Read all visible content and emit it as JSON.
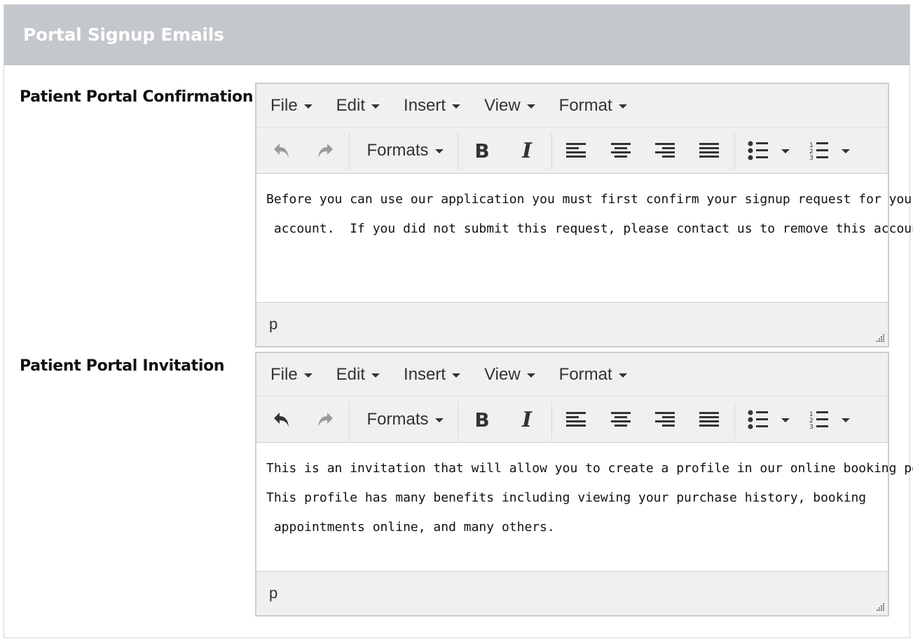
{
  "panel": {
    "title": "Portal Signup Emails"
  },
  "menus": [
    {
      "label": "File"
    },
    {
      "label": "Edit"
    },
    {
      "label": "Insert"
    },
    {
      "label": "View"
    },
    {
      "label": "Format"
    }
  ],
  "toolbar": {
    "formats_label": "Formats"
  },
  "editors": [
    {
      "label": "Patient Portal Confirmation",
      "undo_enabled": false,
      "content_lines": [
        "Before you can use our application you must first confirm your signup request for your",
        " account.  If you did not submit this request, please contact us to remove this account."
      ],
      "path": "p"
    },
    {
      "label": "Patient Portal Invitation",
      "undo_enabled": true,
      "content_lines": [
        "This is an invitation that will allow you to create a profile in our online booking portal.",
        "This profile has many benefits including viewing your purchase history, booking",
        " appointments online, and many others."
      ],
      "path": "p"
    }
  ],
  "icons": [
    "undo-icon",
    "redo-icon",
    "bold-icon",
    "italic-icon",
    "align-left-icon",
    "align-center-icon",
    "align-right-icon",
    "align-justify-icon",
    "bullet-list-icon",
    "numbered-list-icon",
    "resize-handle-icon"
  ],
  "colors": {
    "header_bg": "#c4c7cb",
    "toolbar_bg": "#f0f0f0",
    "disabled_icon": "#9a9a9a",
    "enabled_icon": "#333333"
  }
}
